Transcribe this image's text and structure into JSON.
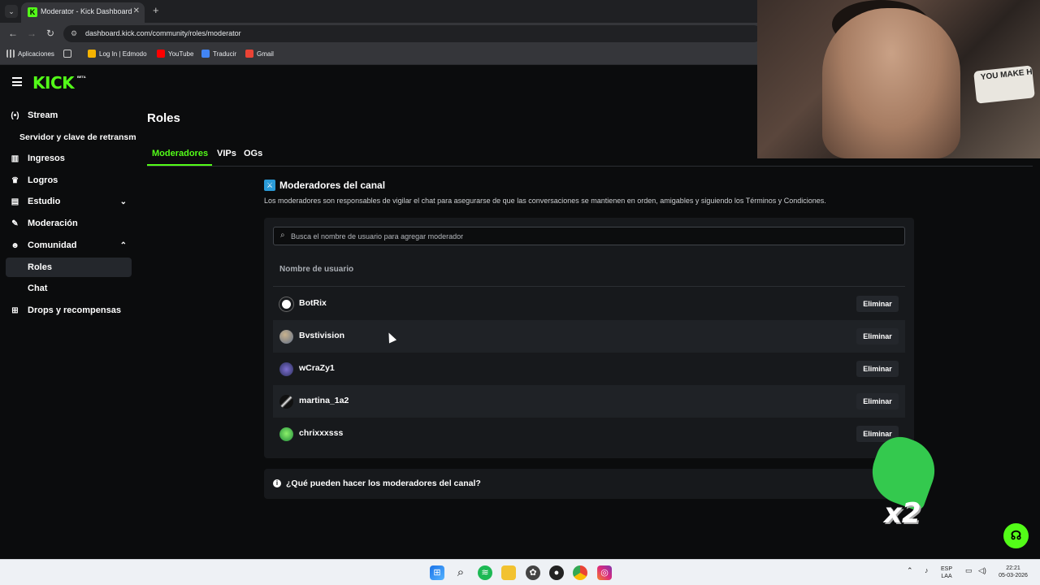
{
  "browser": {
    "tab_title": "Moderator - Kick Dashboard",
    "tab_favicon": "K",
    "url": "dashboard.kick.com/community/roles/moderator",
    "bookmarks": [
      "Aplicaciones",
      "Log In | Edmodo",
      "YouTube",
      "Traducir",
      "Gmail"
    ]
  },
  "app": {
    "logo": "KICK",
    "logo_badge": "BETA",
    "sidebar": [
      {
        "label": "Stream",
        "icon": "broadcast-icon"
      },
      {
        "label": "Servidor y clave de retransm",
        "icon": ""
      },
      {
        "label": "Ingresos",
        "icon": "chart-icon"
      },
      {
        "label": "Logros",
        "icon": "trophy-icon"
      },
      {
        "label": "Estudio",
        "icon": "studio-icon"
      },
      {
        "label": "Moderación",
        "icon": "wrench-icon"
      },
      {
        "label": "Comunidad",
        "icon": "community-icon"
      },
      {
        "label": "Roles",
        "icon": ""
      },
      {
        "label": "Chat",
        "icon": ""
      },
      {
        "label": "Drops y recompensas",
        "icon": "gift-icon"
      }
    ],
    "page_title": "Roles",
    "tabs": [
      "Moderadores",
      "VIPs",
      "OGs"
    ],
    "active_tab": "Moderadores",
    "accent": "#53fc18"
  },
  "moderators": {
    "title": "Moderadores del canal",
    "description": "Los moderadores son responsables de vigilar el chat para asegurarse de que las conversaciones se mantienen en orden, amigables y siguiendo los Términos y Condiciones.",
    "search_placeholder": "Busca el nombre de usuario para agregar moderador",
    "column_header": "Nombre de usuario",
    "remove_label": "Eliminar",
    "users": [
      "BotRix",
      "Bvstivision",
      "wCraZy1",
      "martina_1a2",
      "chrixxxsss"
    ],
    "faq": "¿Qué pueden hacer los moderadores del canal?"
  },
  "overlay": {
    "multiplier": "x2",
    "pillow_text": "YOU MAKE H"
  },
  "taskbar": {
    "lang_top": "ESP",
    "lang_bottom": "LAA",
    "time": "22:21",
    "date": "05-03-2026"
  }
}
